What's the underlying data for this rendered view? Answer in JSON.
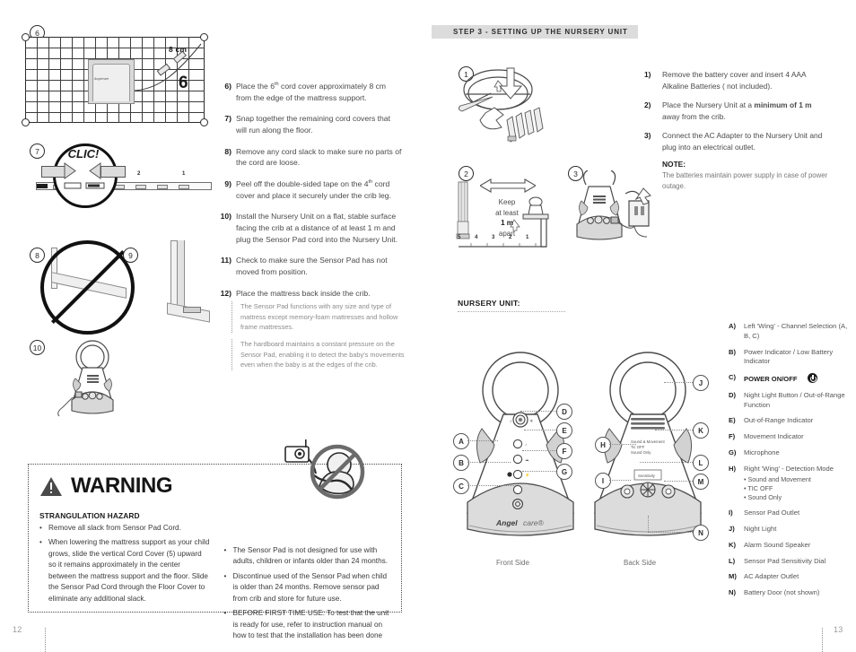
{
  "left_page": {
    "page_number": "12",
    "figure_badges": [
      "6",
      "7",
      "8",
      "9",
      "10"
    ],
    "grid_figure": {
      "dimension_label": "8 cm",
      "big_marker": "6",
      "pad_brand": "Angelcare"
    },
    "clic_figure": {
      "label": "CLIC!",
      "tick_labels": [
        "4",
        "2",
        "1"
      ]
    },
    "steps": [
      {
        "n": "6)",
        "html": "Place the 6<sup>th</sup> cord cover approximately 8 cm from the edge of the mattress support."
      },
      {
        "n": "7)",
        "html": "Snap together the remaining cord covers that will run along the floor."
      },
      {
        "n": "8)",
        "html": "Remove any cord slack to make sure no parts of the cord are loose."
      },
      {
        "n": "9)",
        "html": "Peel off the double-sided tape on the 4<sup>th</sup> cord cover and place it securely under the crib leg."
      },
      {
        "n": "10)",
        "html": "Install the Nursery Unit on a flat, stable surface facing the crib at a distance of at least 1 m and plug the Sensor Pad cord into the Nursery Unit."
      },
      {
        "n": "11)",
        "html": "Check to make sure the Sensor Pad has not moved from position."
      },
      {
        "n": "12)",
        "html": "Place the mattress back inside the crib."
      }
    ],
    "notes": [
      "The Sensor Pad functions with any size and type of mattress except memory-foam mattresses and hollow frame mattresses.",
      "The hardboard maintains a constant pressure on the Sensor Pad, enabling it to detect the baby's movements even when the baby is at the edges of the crib."
    ],
    "warning": {
      "title": "WARNING",
      "icon": "warning-triangle-icon",
      "left_heading": "STRANGULATION HAZARD",
      "left_bullets": [
        "Remove all slack from Sensor Pad Cord.",
        "When lowering the mattress support as your child grows, slide the vertical Cord Cover (5) upward so it remains approximately in the center between the mattress support and the floor. Slide the Sensor Pad Cord through the Floor Cover to eliminate any additional slack."
      ],
      "right_bullets": [
        "The Sensor Pad is not designed for use with adults, children or infants older than 24 months.",
        "Discontinue used of the Sensor Pad when child is older than 24 months. Remove sensor pad from crib and store for future use.",
        "BEFORE FIRST TIME USE: To test that the unit is ready for use, refer to instruction manual on how to test that the installation has been done"
      ],
      "prohibition_icon": "no-baby-with-cord-icon"
    }
  },
  "right_page": {
    "page_number": "13",
    "step_bar": "STEP 3 - SETTING UP THE NURSERY UNIT",
    "figure_badges": [
      "1",
      "2",
      "3"
    ],
    "distance_figure": {
      "line1": "Keep",
      "line2": "at least",
      "line3": "1 m",
      "line4": "apart",
      "tick_labels": [
        "5",
        "4",
        "3",
        "2",
        "1"
      ]
    },
    "steps": [
      {
        "n": "1)",
        "html": "Remove the battery cover and insert 4 AAA Alkaline Batteries ( not included)."
      },
      {
        "n": "2)",
        "html": "Place the Nursery Unit at a <b>minimum of 1 m</b> away from the crib."
      },
      {
        "n": "3)",
        "html": "Connect the AC Adapter to the Nursery Unit and plug into an electrical outlet."
      }
    ],
    "note": {
      "title": "NOTE:",
      "text": "The batteries maintain power supply in case of power outage."
    },
    "nursery_unit_title": "NURSERY UNIT:",
    "unit_brand": "Angelcare",
    "front_label": "Front Side",
    "back_label": "Back Side",
    "front_callouts": [
      "A",
      "B",
      "C",
      "D",
      "E",
      "F",
      "G"
    ],
    "back_callouts": [
      "H",
      "I",
      "J",
      "K",
      "L",
      "M",
      "N"
    ],
    "back_mode_labels": [
      "Sound & Movement",
      "Tic OFF",
      "Sound Only"
    ],
    "back_dial_label": "Sensitivity",
    "legend": [
      {
        "k": "A)",
        "v": "Left 'Wing' - Channel Selection (A, B, C)"
      },
      {
        "k": "B)",
        "v": "Power Indicator / Low Battery Indicator"
      },
      {
        "k": "C)",
        "v": "POWER ON/OFF",
        "bold": true,
        "icon": "power-icon"
      },
      {
        "k": "D)",
        "v": "Night Light Button / Out-of-Range Function"
      },
      {
        "k": "E)",
        "v": "Out-of-Range Indicator"
      },
      {
        "k": "F)",
        "v": "Movement Indicator"
      },
      {
        "k": "G)",
        "v": "Microphone"
      },
      {
        "k": "H)",
        "v": "Right 'Wing' - Detection Mode",
        "sub": [
          "• Sound and Movement",
          "• TIC OFF",
          "• Sound Only"
        ]
      },
      {
        "k": "I)",
        "v": "Sensor Pad Outlet"
      },
      {
        "k": "J)",
        "v": "Night Light"
      },
      {
        "k": "K)",
        "v": "Alarm Sound Speaker"
      },
      {
        "k": "L)",
        "v": "Sensor Pad Sensitivity Dial"
      },
      {
        "k": "M)",
        "v": "AC Adapter Outlet"
      },
      {
        "k": "N)",
        "v": "Battery Door (not shown)"
      }
    ]
  },
  "colors": {
    "ink": "#3a3a3a",
    "dark": "#1b1b1b",
    "bar": "#dcdcdc",
    "muted": "#8b8b8b"
  }
}
